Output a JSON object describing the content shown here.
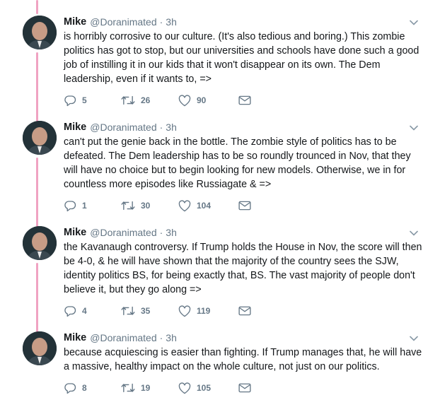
{
  "tweets": [
    {
      "author_name": "Mike",
      "handle": "@Doranimated",
      "separator": "·",
      "time": "3h",
      "text": "is horribly corrosive to our culture. (It's also tedious and boring.)  This zombie\npolitics has got to stop, but our universities and schools have done such a good\njob of instilling it in our kids that it won't disappear on its own. The Dem\nleadership, even if it wants to, =>",
      "replies": "5",
      "retweets": "26",
      "likes": "90"
    },
    {
      "author_name": "Mike",
      "handle": "@Doranimated",
      "separator": "·",
      "time": "3h",
      "text": "can't put the genie back in the bottle. The zombie style of politics has to be\ndefeated. The Dem leadership has to be so roundly trounced in Nov, that they\nwill have no choice but to begin looking for new models. Otherwise, we in for\ncountless more episodes like Russiagate & =>",
      "replies": "1",
      "retweets": "30",
      "likes": "104"
    },
    {
      "author_name": "Mike",
      "handle": "@Doranimated",
      "separator": "·",
      "time": "3h",
      "text": "the Kavanaugh controversy. If Trump holds the House in Nov, the score will then\nbe 4-0, & he will have shown that the majority of the country sees the SJW,\nidentity politics BS, for being exactly that, BS. The vast majority of people don't\nbelieve it, but they go along =>",
      "replies": "4",
      "retweets": "35",
      "likes": "119"
    },
    {
      "author_name": "Mike",
      "handle": "@Doranimated",
      "separator": "·",
      "time": "3h",
      "text": "because acquiescing is easier than fighting.  If Trump manages that, he will have\na massive, healthy impact on the whole culture, not just on our politics.",
      "replies": "8",
      "retweets": "19",
      "likes": "105"
    }
  ],
  "icons": {
    "reply": "reply-icon",
    "retweet": "retweet-icon",
    "like": "heart-icon",
    "dm": "envelope-icon",
    "caret": "chevron-down-icon",
    "avatar": "avatar"
  },
  "colors": {
    "thread_line": "#f0a3c2",
    "secondary_text": "#657786",
    "primary_text": "#14171a"
  }
}
